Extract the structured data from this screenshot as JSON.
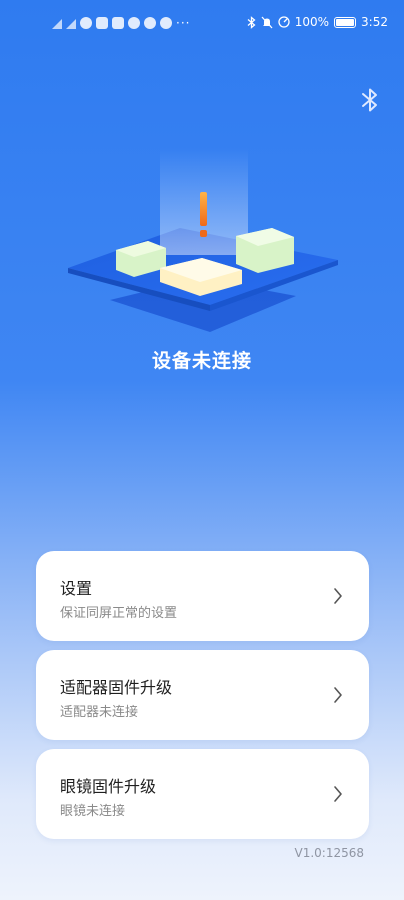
{
  "status_bar": {
    "battery": "100%",
    "time": "3:52"
  },
  "device": {
    "status_text": "设备未连接"
  },
  "menu": [
    {
      "title": "设置",
      "subtitle": "保证同屏正常的设置"
    },
    {
      "title": "适配器固件升级",
      "subtitle": "适配器未连接"
    },
    {
      "title": "眼镜固件升级",
      "subtitle": "眼镜未连接"
    }
  ],
  "footer": {
    "version": "V1.0:12568"
  },
  "icons": {
    "bluetooth": "bluetooth-icon",
    "chevron": "chevron-right-icon",
    "warning": "exclamation-icon"
  },
  "colors": {
    "primary_blue": "#2f7bf0",
    "warning_orange": "#f58a1f",
    "card_bg": "#ffffff"
  }
}
